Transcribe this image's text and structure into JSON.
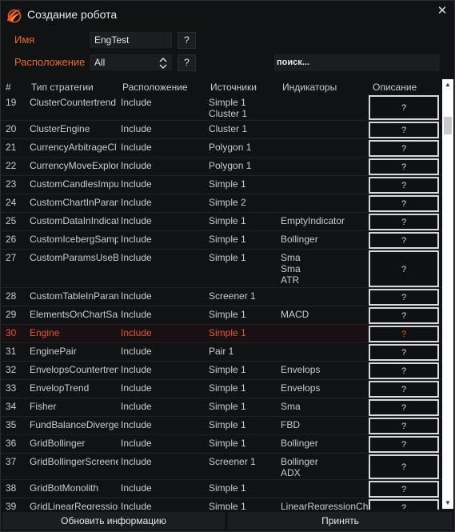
{
  "window": {
    "title": "Создание робота",
    "close_glyph": "✕"
  },
  "form": {
    "name_label": "Имя",
    "name_value": "EngTest",
    "location_label": "Расположение",
    "location_value": "All",
    "help_glyph": "?",
    "search_placeholder": "поиск..."
  },
  "columns": [
    "#",
    "Тип стратегии",
    "Расположение",
    "Источники",
    "Индикаторы",
    "Описание"
  ],
  "rows": [
    {
      "num": "19",
      "type": "ClusterCountertrend",
      "location": "Include",
      "sources": "Simple 1\nCluster 1",
      "indicators": "",
      "desc": "?"
    },
    {
      "num": "20",
      "type": "ClusterEngine",
      "location": "Include",
      "sources": "Cluster 1",
      "indicators": "",
      "desc": "?"
    },
    {
      "num": "21",
      "type": "CurrencyArbitrageCl",
      "location": "Include",
      "sources": "Polygon 1",
      "indicators": "",
      "desc": "?"
    },
    {
      "num": "22",
      "type": "CurrencyMoveExplor",
      "location": "Include",
      "sources": "Polygon 1",
      "indicators": "",
      "desc": "?"
    },
    {
      "num": "23",
      "type": "CustomCandlesImpu",
      "location": "Include",
      "sources": "Simple 1",
      "indicators": "",
      "desc": "?"
    },
    {
      "num": "24",
      "type": "CustomChartInParan",
      "location": "Include",
      "sources": "Simple 2",
      "indicators": "",
      "desc": "?"
    },
    {
      "num": "25",
      "type": "CustomDataInIndicat",
      "location": "Include",
      "sources": "Simple 1",
      "indicators": "EmptyIndicator",
      "desc": "?"
    },
    {
      "num": "26",
      "type": "CustomIcebergSamp",
      "location": "Include",
      "sources": "Simple 1",
      "indicators": "Bollinger",
      "desc": "?"
    },
    {
      "num": "27",
      "type": "CustomParamsUseBc",
      "location": "Include",
      "sources": "Simple 1",
      "indicators": "Sma\nSma\nATR",
      "desc": "?"
    },
    {
      "num": "28",
      "type": "CustomTableInParam",
      "location": "Include",
      "sources": "Screener 1",
      "indicators": "",
      "desc": "?"
    },
    {
      "num": "29",
      "type": "ElementsOnChartSar",
      "location": "Include",
      "sources": "Simple 1",
      "indicators": "MACD",
      "desc": "?"
    },
    {
      "num": "30",
      "type": "Engine",
      "location": "Include",
      "sources": "Simple 1",
      "indicators": "",
      "desc": "?",
      "selected": true
    },
    {
      "num": "31",
      "type": "EnginePair",
      "location": "Include",
      "sources": "Pair 1",
      "indicators": "",
      "desc": "?"
    },
    {
      "num": "32",
      "type": "EnvelopsCountertren",
      "location": "Include",
      "sources": "Simple 1",
      "indicators": "Envelops",
      "desc": "?"
    },
    {
      "num": "33",
      "type": "EnvelopTrend",
      "location": "Include",
      "sources": "Simple 1",
      "indicators": "Envelops",
      "desc": "?"
    },
    {
      "num": "34",
      "type": "Fisher",
      "location": "Include",
      "sources": "Simple 1",
      "indicators": "Sma",
      "desc": "?"
    },
    {
      "num": "35",
      "type": "FundBalanceDiverger",
      "location": "Include",
      "sources": "Simple 1",
      "indicators": "FBD",
      "desc": "?"
    },
    {
      "num": "36",
      "type": "GridBollinger",
      "location": "Include",
      "sources": "Simple 1",
      "indicators": "Bollinger",
      "desc": "?"
    },
    {
      "num": "37",
      "type": "GridBollingerScreene",
      "location": "Include",
      "sources": "Screener 1",
      "indicators": "Bollinger\nADX",
      "desc": "?"
    },
    {
      "num": "38",
      "type": "GridBotMonolith",
      "location": "Include",
      "sources": "Simple 1",
      "indicators": "",
      "desc": "?"
    },
    {
      "num": "39",
      "type": "GridLinearRegression",
      "location": "Include",
      "sources": "Simple 1",
      "indicators": "LinearRegressionCha",
      "desc": "?"
    }
  ],
  "buttons": {
    "refresh": "Обновить информацию",
    "accept": "Принять"
  },
  "colors": {
    "accent": "#e36d2b",
    "selected_text": "#e3572b",
    "background": "#111214"
  }
}
